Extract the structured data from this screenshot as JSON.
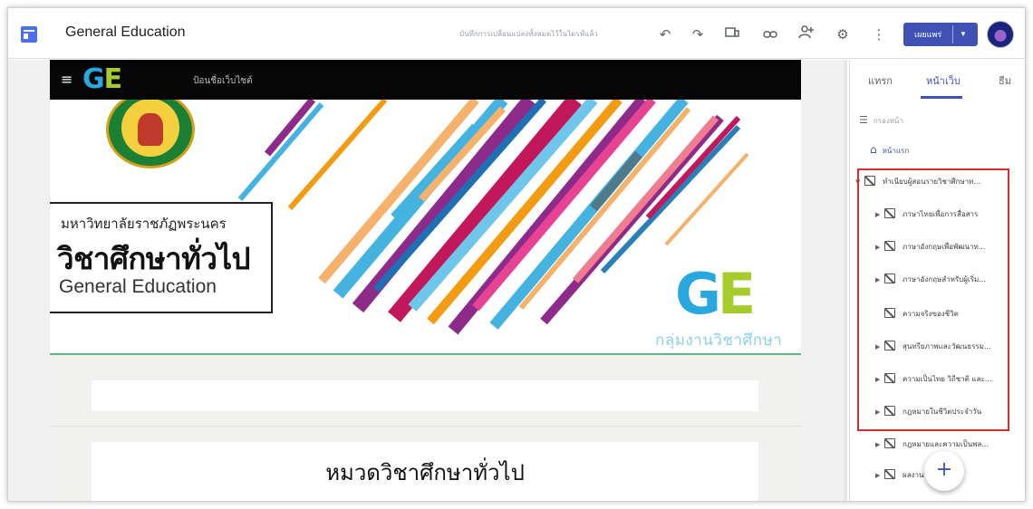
{
  "topbar": {
    "title": "General Education",
    "save_status": "บันทึกการเปลี่ยนแปลงทั้งหมดไว้ในไดรฟ์แล้ว",
    "publish_label": "เผยแพร่",
    "icons": [
      "undo-icon",
      "redo-icon",
      "preview-icon",
      "link-icon",
      "share-icon",
      "settings-icon",
      "more-icon"
    ]
  },
  "site": {
    "site_name": "ป้อนชื่อเว็บไซต์",
    "logo_g": "G",
    "logo_e": "E",
    "univ_name": "มหาวิทยาลัยราชภัฏพระนคร",
    "gened_thai": "วิชาศึกษาทั่วไป",
    "gened_en": "General Education",
    "group_label": "กลุ่มงานวิชาศึกษาทั่วไป",
    "section_heading": "หมวดวิชาศึกษาทั่วไป"
  },
  "panel": {
    "tabs": [
      "แทรก",
      "หน้าเว็บ",
      "ธีม"
    ],
    "active_tab": "หน้าเว็บ",
    "filter_label": "กรองหน้า",
    "home_label": "หน้าแรก",
    "pages": [
      {
        "label": "ทำเนียบผู้สอนรายวิชาศึกษาท...",
        "expandable": true,
        "level": 0
      },
      {
        "label": "ภาษาไทยเพื่อการสื่อสาร",
        "expandable": true,
        "level": 1
      },
      {
        "label": "ภาษาอังกฤษเพื่อพัฒนาท...",
        "expandable": true,
        "level": 1
      },
      {
        "label": "ภาษาอังกฤษสำหรับผู้เริ่ม...",
        "expandable": true,
        "level": 1
      },
      {
        "label": "ความจริงของชีวิต",
        "expandable": false,
        "level": 1
      },
      {
        "label": "สุนทรียภาพและวัฒนธรรม...",
        "expandable": true,
        "level": 1
      },
      {
        "label": "ความเป็นไทย วิถีชาติ และ...",
        "expandable": true,
        "level": 1
      },
      {
        "label": "กฎหมายในชีวิตประจำวัน",
        "expandable": true,
        "level": 1
      },
      {
        "label": "กฎหมายและความเป็นพล...",
        "expandable": true,
        "level": 1
      },
      {
        "label": "ผลงานวิทยาศาสตร์",
        "expandable": true,
        "level": 1
      }
    ],
    "fab_label": "+"
  },
  "colors": {
    "accent": "#3f51b5",
    "highlight": "#d32f2f",
    "ge_blue": "#29a8e0",
    "ge_green": "#a5cc2b"
  }
}
